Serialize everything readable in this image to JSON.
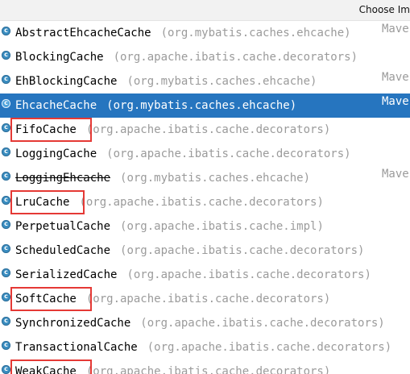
{
  "title": "Choose Im",
  "items": [
    {
      "name": "AbstractEhcacheCache",
      "package": "(org.mybatis.caches.ehcache)",
      "suffix": "Mave",
      "selected": false,
      "strikethrough": false,
      "highlighted": false
    },
    {
      "name": "BlockingCache",
      "package": "(org.apache.ibatis.cache.decorators)",
      "suffix": "",
      "selected": false,
      "strikethrough": false,
      "highlighted": false
    },
    {
      "name": "EhBlockingCache",
      "package": "(org.mybatis.caches.ehcache)",
      "suffix": "Mave",
      "selected": false,
      "strikethrough": false,
      "highlighted": false
    },
    {
      "name": "EhcacheCache",
      "package": "(org.mybatis.caches.ehcache)",
      "suffix": "Mave",
      "selected": true,
      "strikethrough": false,
      "highlighted": false
    },
    {
      "name": "FifoCache",
      "package": "(org.apache.ibatis.cache.decorators)",
      "suffix": "",
      "selected": false,
      "strikethrough": false,
      "highlighted": true
    },
    {
      "name": "LoggingCache",
      "package": "(org.apache.ibatis.cache.decorators)",
      "suffix": "",
      "selected": false,
      "strikethrough": false,
      "highlighted": false
    },
    {
      "name": "LoggingEhcache",
      "package": "(org.mybatis.caches.ehcache)",
      "suffix": "Mave",
      "selected": false,
      "strikethrough": true,
      "highlighted": false
    },
    {
      "name": "LruCache",
      "package": "(org.apache.ibatis.cache.decorators)",
      "suffix": "",
      "selected": false,
      "strikethrough": false,
      "highlighted": true
    },
    {
      "name": "PerpetualCache",
      "package": "(org.apache.ibatis.cache.impl)",
      "suffix": "",
      "selected": false,
      "strikethrough": false,
      "highlighted": false
    },
    {
      "name": "ScheduledCache",
      "package": "(org.apache.ibatis.cache.decorators)",
      "suffix": "",
      "selected": false,
      "strikethrough": false,
      "highlighted": false
    },
    {
      "name": "SerializedCache",
      "package": "(org.apache.ibatis.cache.decorators)",
      "suffix": "",
      "selected": false,
      "strikethrough": false,
      "highlighted": false
    },
    {
      "name": "SoftCache",
      "package": "(org.apache.ibatis.cache.decorators)",
      "suffix": "",
      "selected": false,
      "strikethrough": false,
      "highlighted": true
    },
    {
      "name": "SynchronizedCache",
      "package": "(org.apache.ibatis.cache.decorators)",
      "suffix": "",
      "selected": false,
      "strikethrough": false,
      "highlighted": false
    },
    {
      "name": "TransactionalCache",
      "package": "(org.apache.ibatis.cache.decorators)",
      "suffix": "",
      "selected": false,
      "strikethrough": false,
      "highlighted": false
    },
    {
      "name": "WeakCache",
      "package": "(org.apache.ibatis.cache.decorators)",
      "suffix": "",
      "selected": false,
      "strikethrough": false,
      "highlighted": true
    }
  ],
  "colors": {
    "selection": "#2675bf",
    "highlight_box": "#e53935",
    "package_text": "#9b9b9b",
    "class_icon": "#3b8ec1"
  },
  "icons": {
    "class": "class-c-icon"
  }
}
